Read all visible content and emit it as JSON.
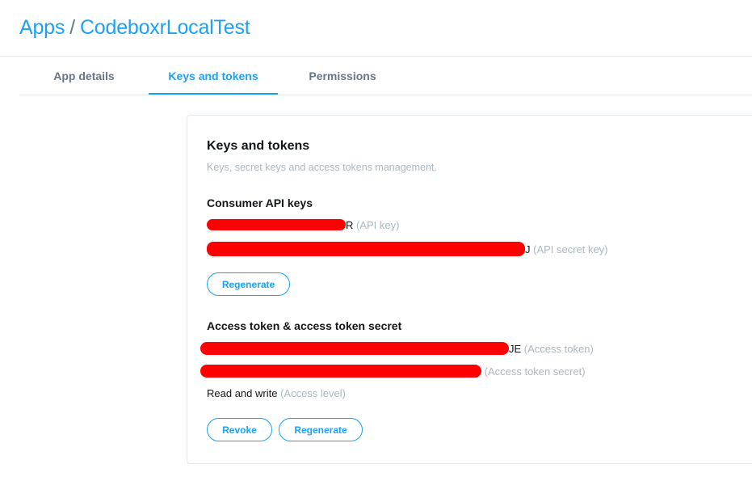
{
  "breadcrumb": {
    "root": "Apps",
    "separator": "/",
    "current": "CodeboxrLocalTest"
  },
  "tabs": [
    {
      "label": "App details",
      "active": false
    },
    {
      "label": "Keys and tokens",
      "active": true
    },
    {
      "label": "Permissions",
      "active": false
    }
  ],
  "card": {
    "title": "Keys and tokens",
    "subtitle": "Keys, secret keys and access tokens management.",
    "consumer": {
      "title": "Consumer API keys",
      "api_key_tail": "R",
      "api_key_label": "(API key)",
      "api_secret_tail": "J",
      "api_secret_label": "(API secret key)",
      "regenerate_label": "Regenerate"
    },
    "access": {
      "title": "Access token & access token secret",
      "token_tail": "JE",
      "token_label": "(Access token)",
      "secret_label": "(Access token secret)",
      "level_value": "Read and write",
      "level_label": "(Access level)",
      "revoke_label": "Revoke",
      "regenerate_label": "Regenerate"
    }
  },
  "colors": {
    "accent": "#1da1f2",
    "muted": "#aab8c2",
    "redaction": "#ff0000"
  }
}
